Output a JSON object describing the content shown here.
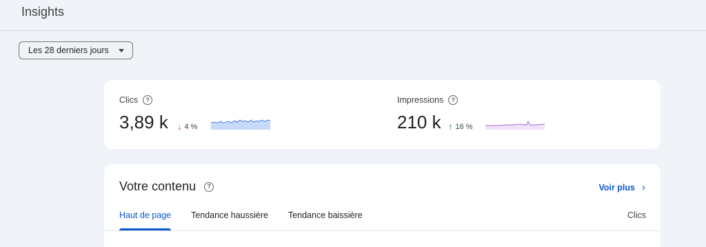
{
  "page": {
    "title": "Insights"
  },
  "date_filter": {
    "selected": "Les 28 derniers jours"
  },
  "metrics": {
    "clicks": {
      "label": "Clics",
      "value": "3,89 k",
      "change": "4 %",
      "direction": "down",
      "spark_color": "#4a7fe0",
      "spark_fill": "#c7dafb"
    },
    "impressions": {
      "label": "Impressions",
      "value": "210 k",
      "change": "16 %",
      "direction": "up",
      "spark_color": "#a66bd6",
      "spark_fill": "#efe2fa"
    }
  },
  "content": {
    "title": "Votre contenu",
    "see_more": "Voir plus",
    "tabs": [
      "Haut de page",
      "Tendance haussière",
      "Tendance baissière"
    ],
    "active_tab": 0,
    "column_header": "Clics"
  },
  "colors": {
    "accent": "#0b57d0",
    "down": "#d93025",
    "up": "#188038",
    "background": "#f0f4f9"
  },
  "icons": {
    "help": "help-circle-icon",
    "caret": "caret-down-icon",
    "chevron": "chevron-right-icon",
    "arrow_down": "arrow-down-icon",
    "arrow_up": "arrow-up-icon"
  }
}
